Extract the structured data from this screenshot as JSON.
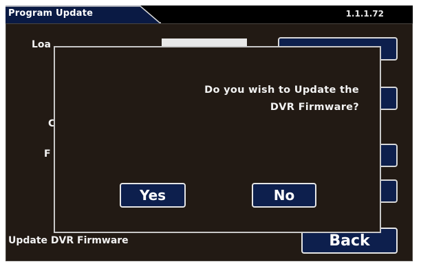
{
  "window": {
    "title": "Program Update",
    "version": "1.1.1.72"
  },
  "background": {
    "rows": [
      {
        "label": "Load Configuration",
        "visible_fragment": "Loa"
      },
      {
        "label": "",
        "visible_fragment": "C"
      },
      {
        "label": "",
        "visible_fragment": "F"
      }
    ],
    "update_firmware_label": "Update DVR Firmware",
    "back_label": "Back"
  },
  "dialog": {
    "message_line1": "Do you wish to Update the",
    "message_line2": "DVR Firmware?",
    "yes_label": "Yes",
    "no_label": "No"
  },
  "colors": {
    "background": "#221a14",
    "button_fill": "#0d1f4d",
    "button_border": "#e6e6e6",
    "title_bar": "#0a1a44",
    "text": "#f2f2f2"
  }
}
